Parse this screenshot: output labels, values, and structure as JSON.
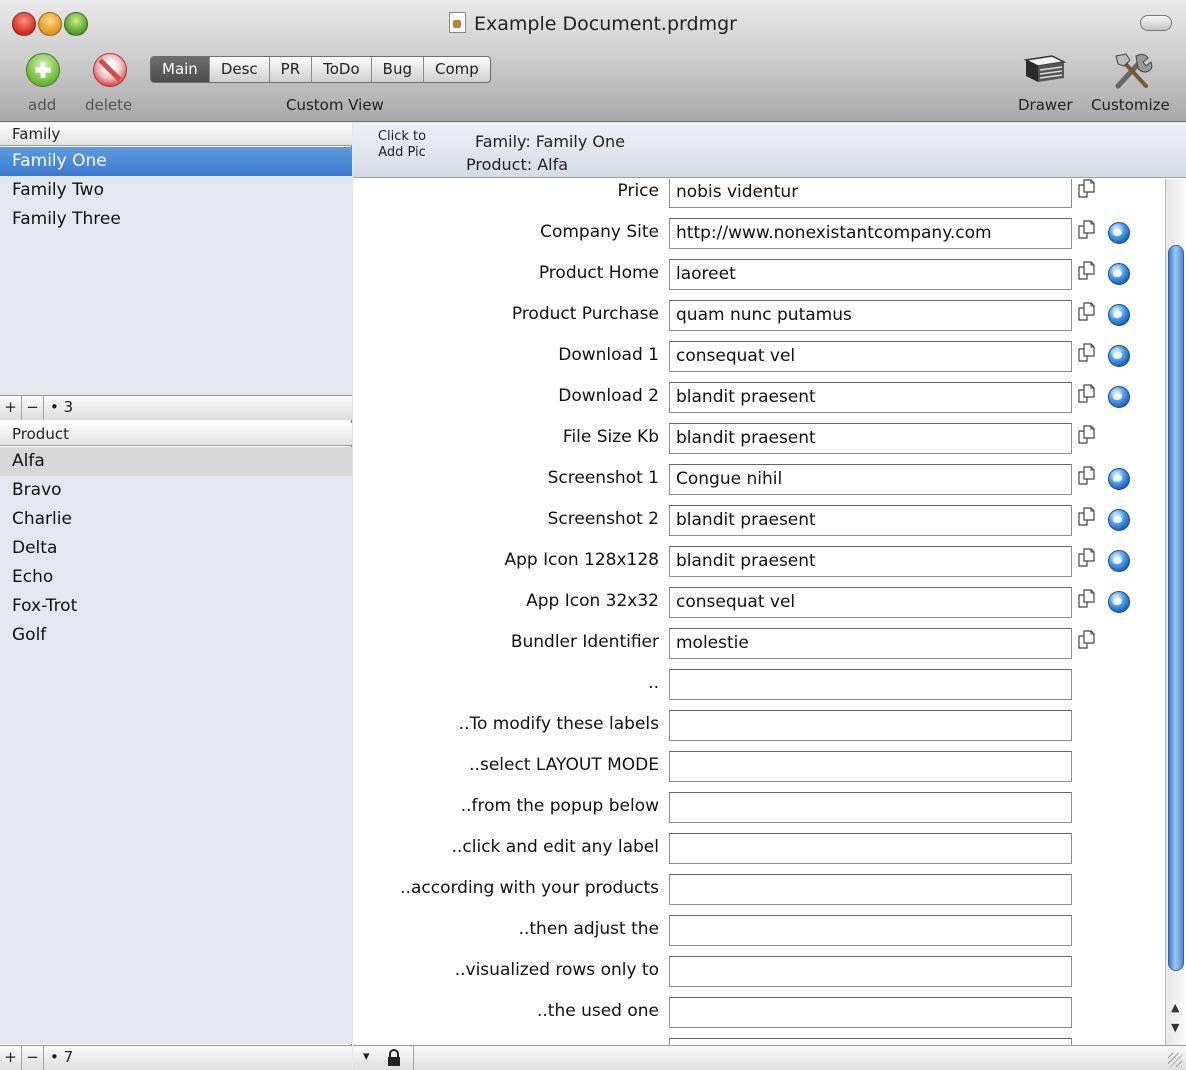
{
  "window": {
    "title": "Example Document.prdmgr"
  },
  "toolbar": {
    "add_label": "add",
    "delete_label": "delete",
    "segments": [
      "Main",
      "Desc",
      "PR",
      "ToDo",
      "Bug",
      "Comp"
    ],
    "active_segment": "Main",
    "custom_view_label": "Custom View",
    "drawer_label": "Drawer",
    "customize_label": "Customize"
  },
  "family_list": {
    "header": "Family",
    "items": [
      "Family One",
      "Family Two",
      "Family Three"
    ],
    "selected": "Family One",
    "add": "+",
    "remove": "−",
    "count": "• 3"
  },
  "product_list": {
    "header": "Product",
    "items": [
      "Alfa",
      "Bravo",
      "Charlie",
      "Delta",
      "Echo",
      "Fox-Trot",
      "Golf"
    ],
    "selected": "Alfa",
    "add": "+",
    "remove": "−",
    "count": "• 7"
  },
  "detail_header": {
    "pic_label": "Click to Add Pic",
    "family_line": "Family:  Family One",
    "product_line": "Product:  Alfa"
  },
  "fields": [
    {
      "label": "Price",
      "value": "nobis videntur",
      "copy": true,
      "globe": false
    },
    {
      "label": "Company Site",
      "value": "http://www.nonexistantcompany.com",
      "copy": true,
      "globe": true
    },
    {
      "label": "Product Home",
      "value": "laoreet",
      "copy": true,
      "globe": true
    },
    {
      "label": "Product Purchase",
      "value": "quam nunc putamus",
      "copy": true,
      "globe": true
    },
    {
      "label": "Download 1",
      "value": "consequat vel",
      "copy": true,
      "globe": true
    },
    {
      "label": "Download 2",
      "value": "blandit praesent",
      "copy": true,
      "globe": true
    },
    {
      "label": "File Size Kb",
      "value": "blandit praesent",
      "copy": true,
      "globe": false
    },
    {
      "label": "Screenshot 1",
      "value": "Congue nihil",
      "copy": true,
      "globe": true
    },
    {
      "label": "Screenshot 2",
      "value": "blandit praesent",
      "copy": true,
      "globe": true
    },
    {
      "label": "App Icon 128x128",
      "value": "blandit praesent",
      "copy": true,
      "globe": true
    },
    {
      "label": "App Icon 32x32",
      "value": "consequat vel",
      "copy": true,
      "globe": true
    },
    {
      "label": "Bundler Identifier",
      "value": "molestie",
      "copy": true,
      "globe": false
    },
    {
      "label": "..",
      "value": "",
      "copy": false,
      "globe": false
    },
    {
      "label": "..To modify these labels",
      "value": "",
      "copy": false,
      "globe": false
    },
    {
      "label": "..select LAYOUT MODE",
      "value": "",
      "copy": false,
      "globe": false
    },
    {
      "label": "..from the popup below",
      "value": "",
      "copy": false,
      "globe": false
    },
    {
      "label": "..click and edit any label",
      "value": "",
      "copy": false,
      "globe": false
    },
    {
      "label": "..according with your products",
      "value": "",
      "copy": false,
      "globe": false
    },
    {
      "label": "..then adjust the",
      "value": "",
      "copy": false,
      "globe": false
    },
    {
      "label": "..visualized rows only to",
      "value": "",
      "copy": false,
      "globe": false
    },
    {
      "label": "..the used one",
      "value": "",
      "copy": false,
      "globe": false
    },
    {
      "label": "",
      "value": "",
      "copy": false,
      "globe": false
    }
  ],
  "footer": {
    "layout_popup": "▾"
  }
}
